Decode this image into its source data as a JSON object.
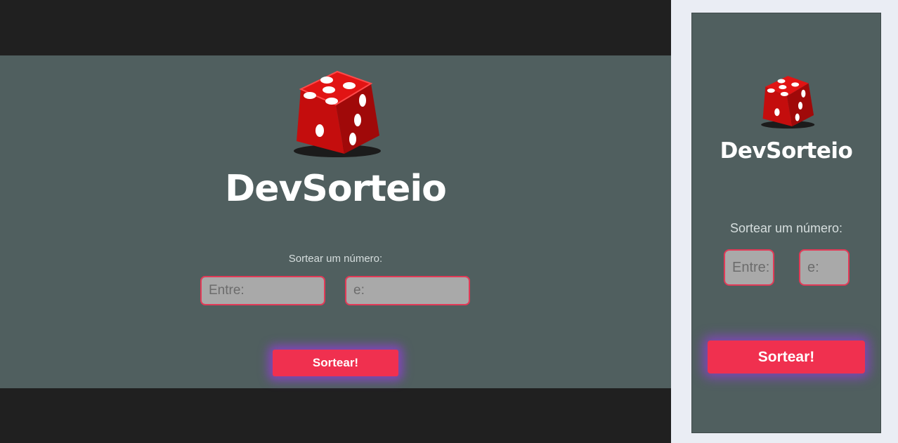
{
  "app": {
    "name": "DevSorteio",
    "logo_icon": "dice-icon"
  },
  "form": {
    "prompt": "Sortear um número:",
    "min_placeholder": "Entre:",
    "max_placeholder": "e:",
    "submit_label": "Sortear!"
  },
  "colors": {
    "page_background": "#202020",
    "panel_background": "#505f5f",
    "accent": "#f0304f",
    "glow": "#963cdc",
    "input_background": "#a9a9a9",
    "input_border": "#e23a57"
  }
}
